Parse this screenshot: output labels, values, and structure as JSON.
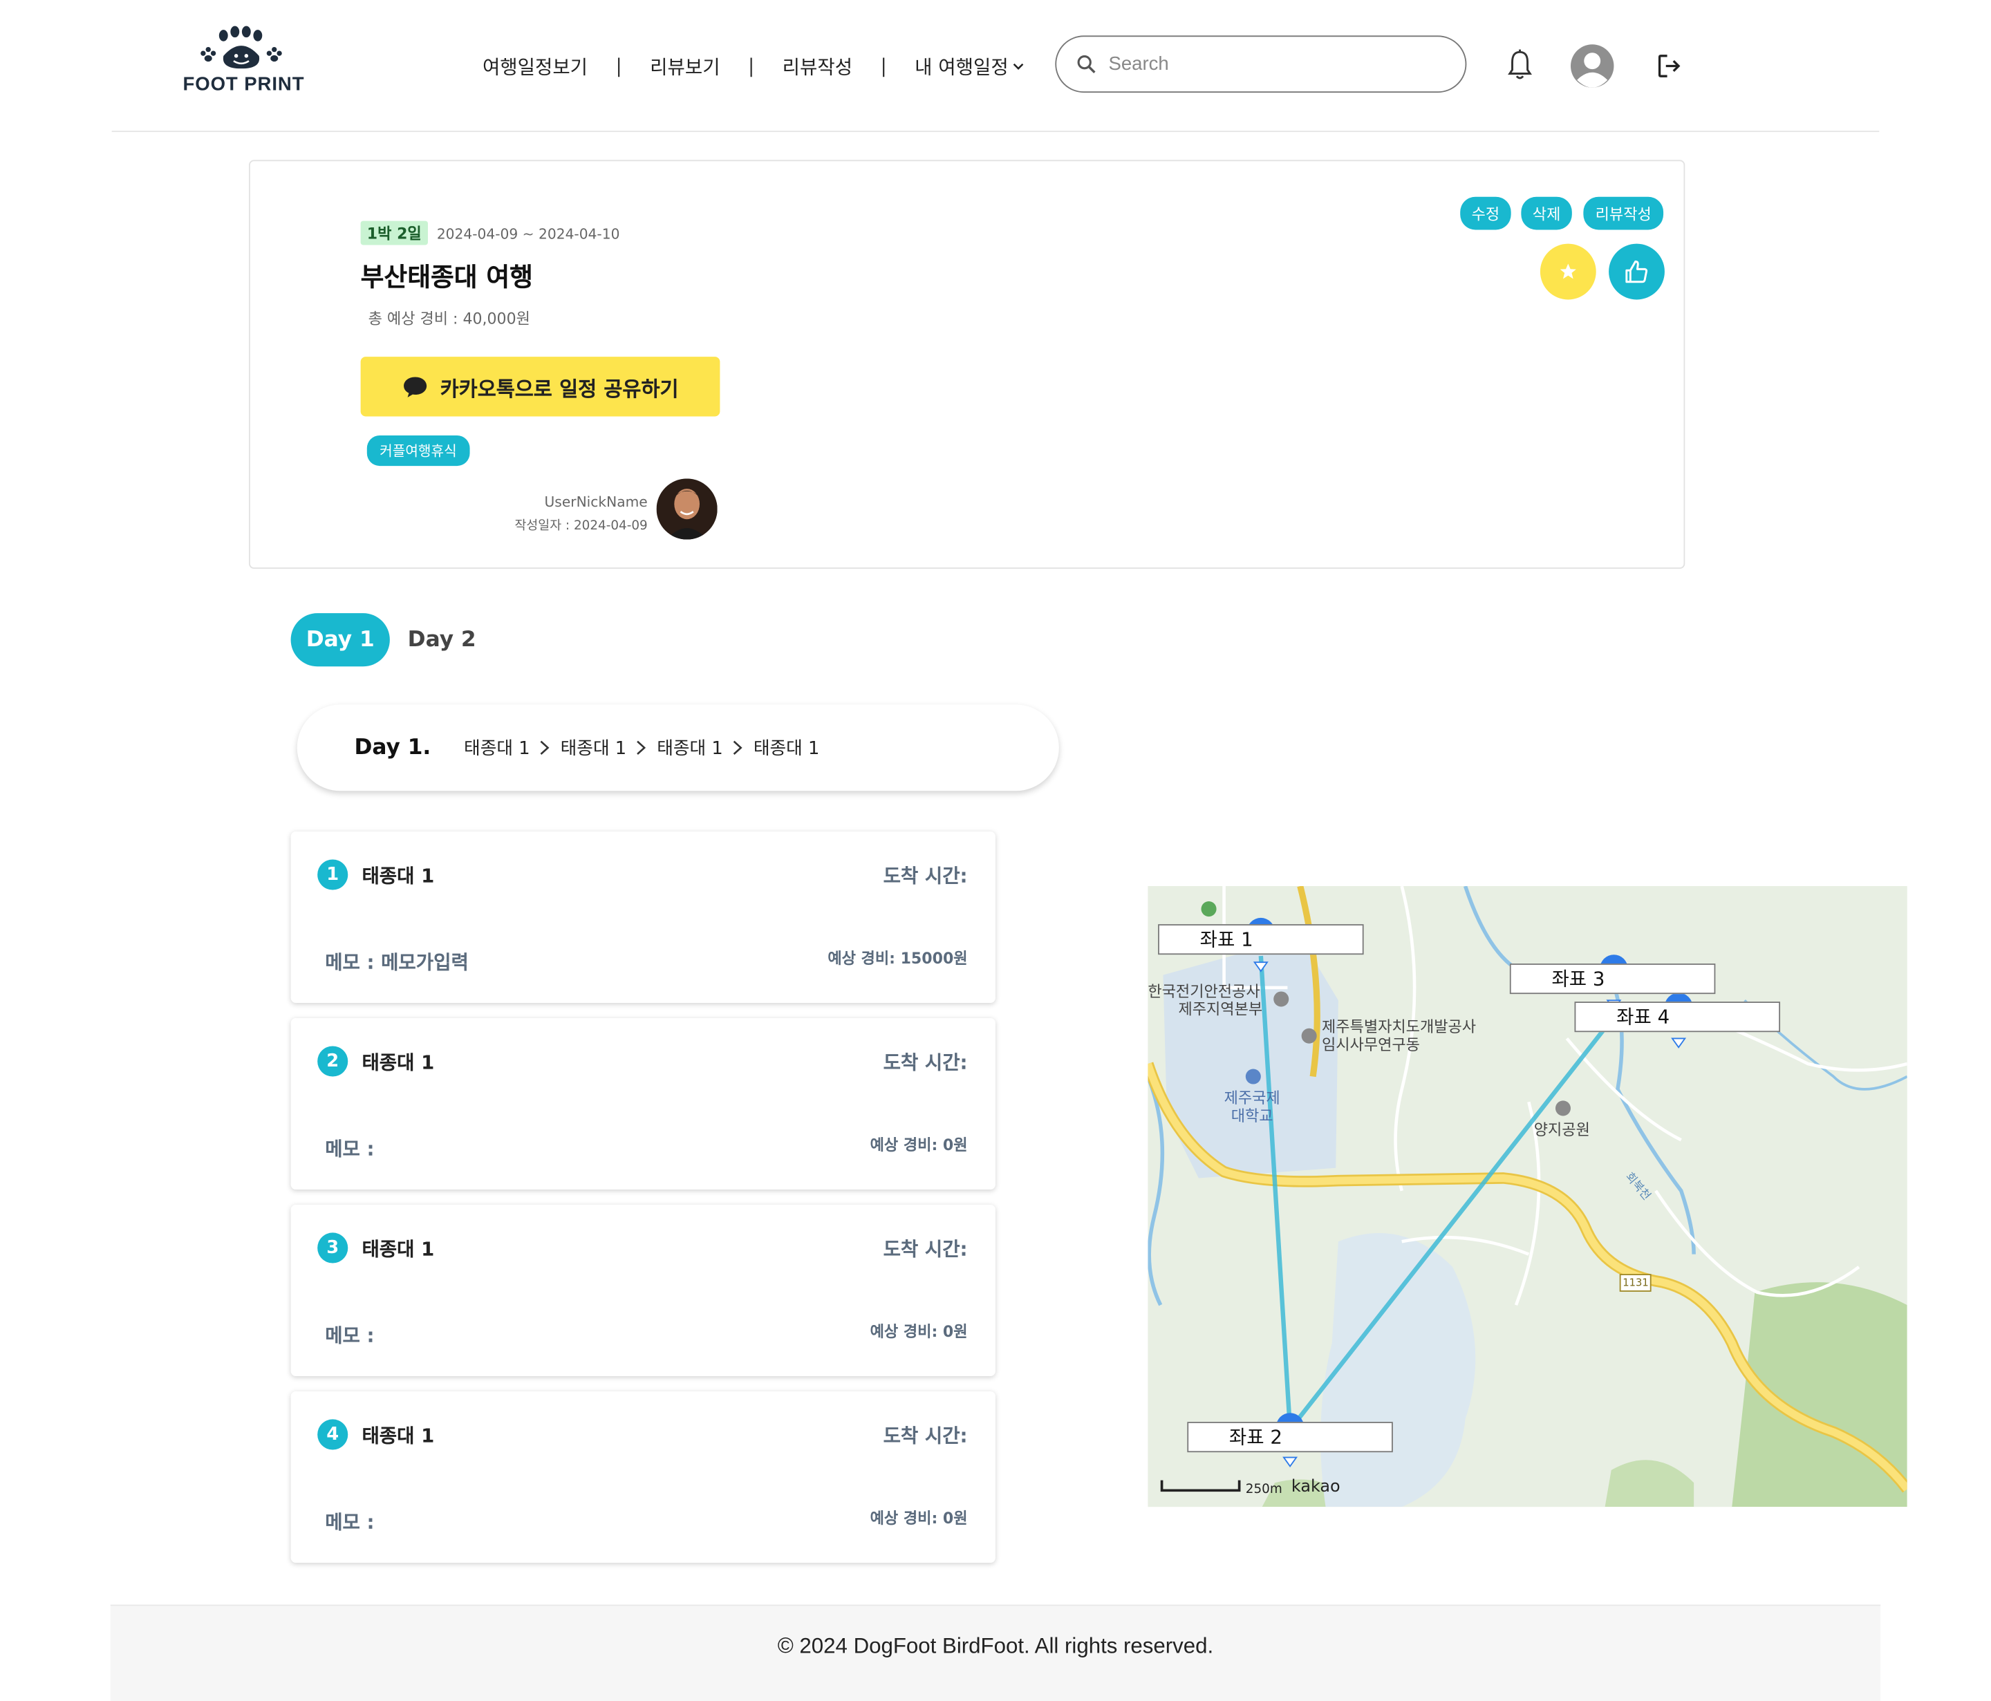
{
  "header": {
    "logo_text": "FOOT PRINT",
    "nav": [
      "여행일정보기",
      "리뷰보기",
      "리뷰작성"
    ],
    "nav_separator": "|",
    "nav_dropdown": "내 여행일정",
    "search_placeholder": "Search",
    "icons": [
      "bell-icon",
      "user-icon",
      "logout-icon"
    ]
  },
  "trip": {
    "nights_badge": "1박 2일",
    "dates": "2024-04-09 ~ 2024-04-10",
    "title": "부산태종대 여행",
    "budget": "총 예상 경비 : 40,000원",
    "kakao_share": "카카오톡으로 일정 공유하기",
    "tag": "커플여행휴식",
    "author_nickname": "UserNickName",
    "written_date": "작성일자 : 2024-04-09",
    "actions": [
      "수정",
      "삭제",
      "리뷰작성"
    ]
  },
  "days": {
    "tabs": [
      "Day 1",
      "Day 2"
    ],
    "active": "Day 1",
    "route_title": "Day 1.",
    "route": [
      "태종대 1",
      "태종대 1",
      "태종대 1",
      "태종대 1"
    ]
  },
  "places": [
    {
      "num": "1",
      "name": "태종대 1",
      "arrival": "도착 시간:",
      "memo": "메모 : 메모가입력",
      "cost": "예상 경비: 15000원"
    },
    {
      "num": "2",
      "name": "태종대 1",
      "arrival": "도착 시간:",
      "memo": "메모 :",
      "cost": "예상 경비: 0원"
    },
    {
      "num": "3",
      "name": "태종대 1",
      "arrival": "도착 시간:",
      "memo": "메모 :",
      "cost": "예상 경비: 0원"
    },
    {
      "num": "4",
      "name": "태종대 1",
      "arrival": "도착 시간:",
      "memo": "메모 :",
      "cost": "예상 경비: 0원"
    }
  ],
  "map": {
    "markers": [
      "좌표 1",
      "좌표 2",
      "좌표 3",
      "좌표 4"
    ],
    "places": {
      "p1_line1": "한국전기안전공사",
      "p1_line2": "제주지역본부",
      "p2_line1": "제주특별자치도개발공사",
      "p2_line2": "임시사무연구동",
      "p3_line1": "제주국제",
      "p3_line2": "대학교",
      "p4": "양지공원",
      "stream": "회북천",
      "road": "1131"
    },
    "scale": "250m",
    "provider": "kakao"
  },
  "footer": {
    "copyright": "© 2024 DogFoot BirdFoot. All rights reserved."
  },
  "colors": {
    "accent": "#19b8cf",
    "kakao": "#fde44d",
    "star": "#fde44d"
  }
}
